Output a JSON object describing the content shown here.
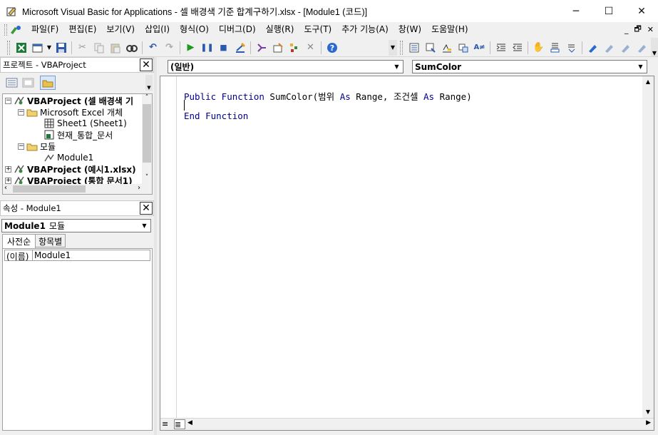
{
  "window": {
    "title": "Microsoft Visual Basic for Applications - 셀 배경색 기준 합계구하기.xlsx - [Module1 (코드)]",
    "minimize": "─",
    "maximize": "☐",
    "close": "✕"
  },
  "menubar": {
    "items": [
      "파일(F)",
      "편집(E)",
      "보기(V)",
      "삽입(I)",
      "형식(O)",
      "디버그(D)",
      "실행(R)",
      "도구(T)",
      "추가 기능(A)",
      "창(W)",
      "도움말(H)"
    ],
    "mdi_minimize": "_",
    "mdi_restore": "🗗",
    "mdi_close": "✕"
  },
  "project_pane": {
    "title": "프로젝트 - VBAProject",
    "tree": [
      {
        "label": "VBAProject (셀 배경색 기",
        "bold": true
      },
      {
        "label": "Microsoft Excel 개체",
        "bold": false
      },
      {
        "label": "Sheet1 (Sheet1)",
        "bold": false
      },
      {
        "label": "현재_통합_문서",
        "bold": false
      },
      {
        "label": "모듈",
        "bold": false
      },
      {
        "label": "Module1",
        "bold": false
      },
      {
        "label": "VBAProject (예시1.xlsx)",
        "bold": true
      },
      {
        "label": "VBAProject (통합 문서1)",
        "bold": true
      }
    ]
  },
  "properties_pane": {
    "title": "속성 - Module1",
    "object_combo": {
      "name": "Module1",
      "type": "모듈"
    },
    "tabs": [
      "사전순",
      "항목별"
    ],
    "rows": [
      {
        "name": "(이름)",
        "value": "Module1"
      }
    ]
  },
  "code_window": {
    "object_combo": "(일반)",
    "procedure_combo": "SumColor",
    "lines": {
      "l1_kw1": "Public Function",
      "l1_mid": " SumColor(범위 ",
      "l1_kw2": "As",
      "l1_mid2": " Range, 조건셀 ",
      "l1_kw3": "As",
      "l1_end": " Range)",
      "l3_kw": "End Function"
    }
  }
}
